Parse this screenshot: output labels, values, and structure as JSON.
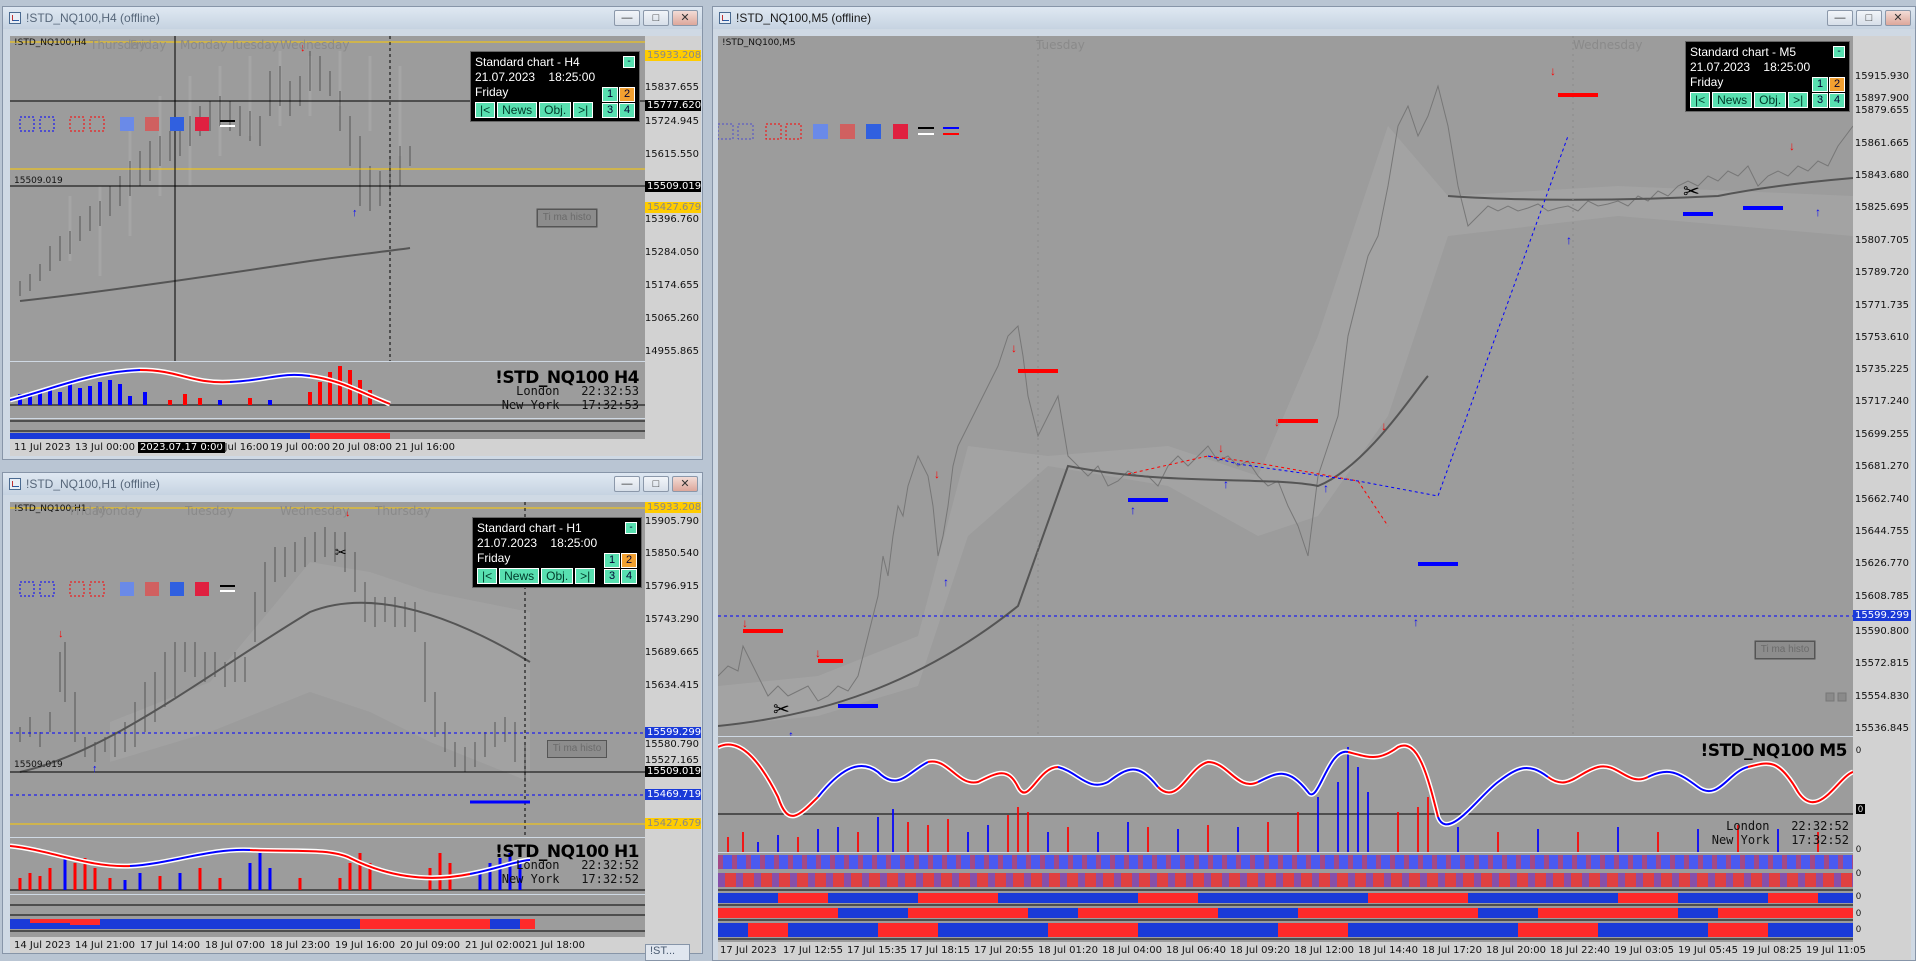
{
  "windows": {
    "h4": {
      "title": "!STD_NQ100,H4 (offline)",
      "symbol_label": "!STD_NQ100,H4",
      "days": [
        "Thursday",
        "Friday",
        "Monday",
        "Tuesday",
        "Wednesday",
        "Thursday",
        "Friday"
      ],
      "price_labels": [
        "15933.208",
        "15837.655",
        "15777.620",
        "15724.945",
        "15615.550",
        "15509.019",
        "15427.679",
        "15396.760",
        "15284.050",
        "15174.655",
        "15065.260",
        "14955.865"
      ],
      "left_marker": "15509.019",
      "times": [
        "11 Jul 2023",
        "13 Jul 00:00",
        "2023.07.17 0:00",
        "7 Jul 16:00",
        "19 Jul 00:00",
        "20 Jul 08:00",
        "21 Jul 16:00"
      ],
      "info": {
        "title": "Standard chart - H4",
        "date": "21.07.2023",
        "time": "18:25:00",
        "day": "Friday"
      },
      "big_name": "!STD_NQ100  H4",
      "clock_london": "London   22:32:53",
      "clock_ny": "New York   17:32:53",
      "hist_label": "Ti ma histo",
      "indicator_zero": "0"
    },
    "h1": {
      "title": "!STD_NQ100,H1 (offline)",
      "symbol_label": "!STD_NQ100,H1",
      "days": [
        "Friday",
        "Monday",
        "Tuesday",
        "Wednesday",
        "Thursday"
      ],
      "price_labels": [
        "15933.208",
        "15905.790",
        "15850.540",
        "15796.915",
        "15743.290",
        "15689.665",
        "15634.415",
        "15599.299",
        "15580.790",
        "15527.165",
        "15509.019",
        "15469.719",
        "15427.679"
      ],
      "left_marker": "15509.019",
      "times": [
        "14 Jul 2023",
        "14 Jul 21:00",
        "17 Jul 14:00",
        "18 Jul 07:00",
        "18 Jul 23:00",
        "19 Jul 16:00",
        "20 Jul 09:00",
        "21 Jul 02:00",
        "21 Jul 18:00"
      ],
      "info": {
        "title": "Standard chart - H1",
        "date": "21.07.2023",
        "time": "18:25:00",
        "day": "Friday"
      },
      "big_name": "!STD_NQ100  H1",
      "clock_london": "London   22:32:52",
      "clock_ny": "New York   17:32:52",
      "hist_label": "Ti ma histo",
      "indicator_zero": "0"
    },
    "m5": {
      "title": "!STD_NQ100,M5 (offline)",
      "symbol_label": "!STD_NQ100,M5",
      "days": [
        "Tuesday",
        "Wednesday"
      ],
      "price_labels": [
        "15915.930",
        "15897.900",
        "15879.655",
        "15861.665",
        "15843.680",
        "15825.695",
        "15807.705",
        "15789.720",
        "15771.735",
        "15753.610",
        "15735.225",
        "15717.240",
        "15699.255",
        "15681.270",
        "15662.740",
        "15644.755",
        "15626.770",
        "15608.785",
        "15599.299",
        "15590.800",
        "15572.815",
        "15554.830",
        "15536.845"
      ],
      "times": [
        "17 Jul 2023",
        "17 Jul 12:55",
        "17 Jul 15:35",
        "17 Jul 18:15",
        "17 Jul 20:55",
        "18 Jul 01:20",
        "18 Jul 04:00",
        "18 Jul 06:40",
        "18 Jul 09:20",
        "18 Jul 12:00",
        "18 Jul 14:40",
        "18 Jul 17:20",
        "18 Jul 20:00",
        "18 Jul 22:40",
        "19 Jul 03:05",
        "19 Jul 05:45",
        "19 Jul 08:25",
        "19 Jul 11:05"
      ],
      "info": {
        "title": "Standard chart - M5",
        "date": "21.07.2023",
        "time": "18:25:00",
        "day": "Friday"
      },
      "big_name": "!STD_NQ100  M5",
      "clock_london": "London   22:32:52",
      "clock_ny": "New York   17:32:52",
      "hist_label": "Ti ma histo",
      "indicator_zero": "0"
    }
  },
  "buttons": {
    "first": "|<",
    "news": "News",
    "obj": "Obj.",
    "last": ">|",
    "n1": "1",
    "n2": "2",
    "n3": "3",
    "n4": "4",
    "collapse": "-"
  },
  "window_buttons": {
    "minimize": "—",
    "maximize": "□",
    "close": "✕"
  },
  "taskbar": {
    "minimized_title": "!ST..."
  },
  "colors": {
    "bg": "#9c9c9c",
    "bull": "#0000ff",
    "bear": "#ff0000",
    "price_line": "#ffcc00"
  }
}
